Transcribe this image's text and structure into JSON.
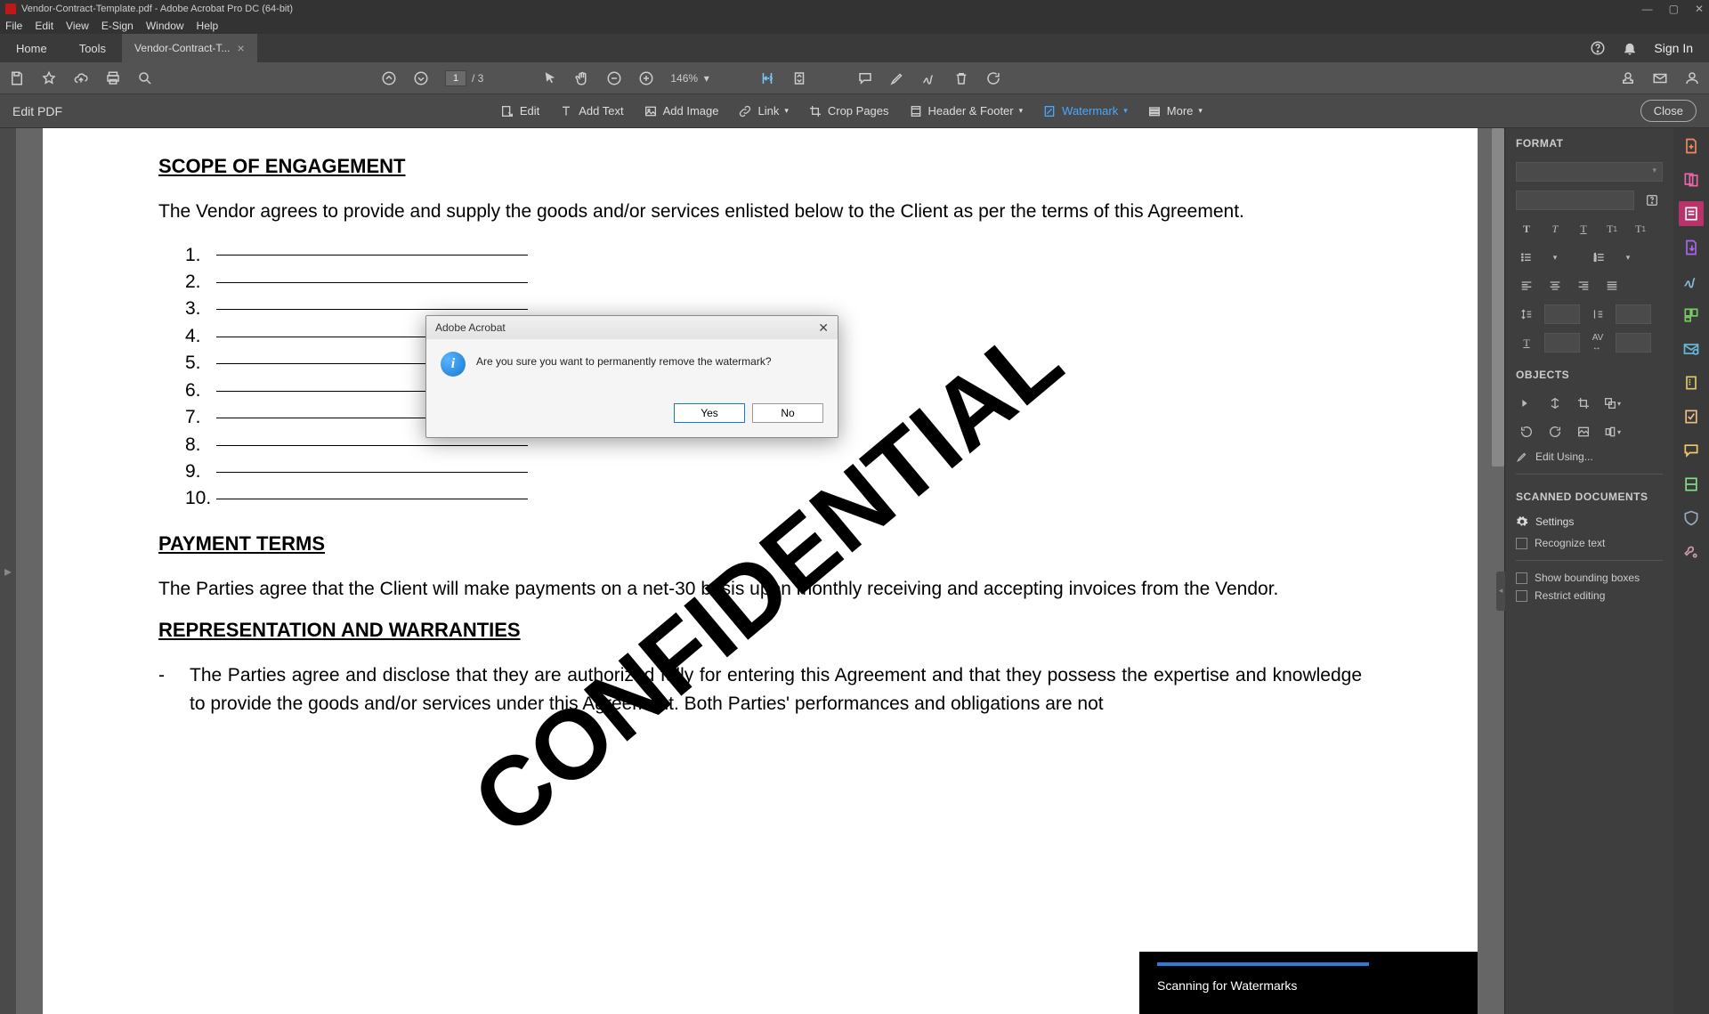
{
  "window": {
    "title": "Vendor-Contract-Template.pdf - Adobe Acrobat Pro DC (64-bit)"
  },
  "menu": [
    "File",
    "Edit",
    "View",
    "E-Sign",
    "Window",
    "Help"
  ],
  "tabs": {
    "home": "Home",
    "tools": "Tools",
    "doc": "Vendor-Contract-T...",
    "signin": "Sign In"
  },
  "toolbar": {
    "page_current": "1",
    "page_total": "/ 3",
    "zoom": "146%"
  },
  "editbar": {
    "title": "Edit PDF",
    "actions": {
      "edit": "Edit",
      "addtext": "Add Text",
      "addimage": "Add Image",
      "link": "Link",
      "crop": "Crop Pages",
      "headerfooter": "Header & Footer",
      "watermark": "Watermark",
      "more": "More"
    },
    "close": "Close"
  },
  "document": {
    "h_scope": "SCOPE OF ENGAGEMENT",
    "p_scope": "The Vendor agrees to provide and supply the goods and/or services enlisted below to the Client as per the terms of this Agreement.",
    "list_nums": [
      "1.",
      "2.",
      "3.",
      "4.",
      "5.",
      "6.",
      "7.",
      "8.",
      "9.",
      "10."
    ],
    "h_pay": "PAYMENT TERMS",
    "p_pay": "The Parties agree that the Client will make payments on a net-30 basis upon monthly receiving and accepting invoices from the Vendor.",
    "h_rep": "REPRESENTATION AND WARRANTIES",
    "bullet_dash": "-",
    "p_rep": "The Parties agree and disclose that they are authorized fully for entering this Agreement and that they possess the expertise and knowledge to provide the goods and/or services under this Agreement. Both Parties' performances and obligations are not",
    "watermark": "CONFIDENTIAL"
  },
  "scan_toast": "Scanning for Watermarks",
  "format_panel": {
    "hdr_format": "FORMAT",
    "hdr_objects": "OBJECTS",
    "edit_using": "Edit Using...",
    "hdr_scanned": "SCANNED DOCUMENTS",
    "settings": "Settings",
    "recognize": "Recognize text",
    "show_bb": "Show bounding boxes",
    "restrict": "Restrict editing"
  },
  "dialog": {
    "title": "Adobe Acrobat",
    "message": "Are you sure you want to permanently remove the watermark?",
    "yes": "Yes",
    "no": "No"
  }
}
